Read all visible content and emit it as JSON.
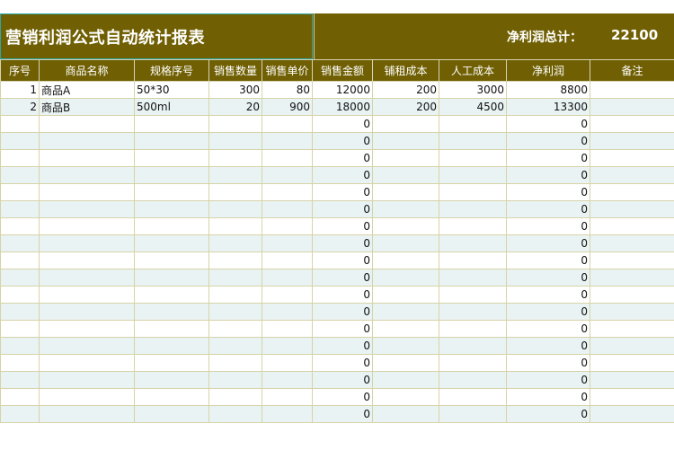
{
  "title": "营销利润公式自动统计报表",
  "summary": {
    "label": "净利润总计：",
    "value": "22100"
  },
  "headers": [
    "序号",
    "商品名称",
    "规格序号",
    "销售数量",
    "销售单价",
    "销售金额",
    "铺租成本",
    "人工成本",
    "净利润",
    "备注"
  ],
  "rows": [
    [
      "1",
      "商品A",
      "50*30",
      "300",
      "80",
      "12000",
      "200",
      "3000",
      "8800",
      ""
    ],
    [
      "2",
      "商品B",
      "500ml",
      "20",
      "900",
      "18000",
      "200",
      "4500",
      "13300",
      ""
    ],
    [
      "",
      "",
      "",
      "",
      "",
      "0",
      "",
      "",
      "0",
      ""
    ],
    [
      "",
      "",
      "",
      "",
      "",
      "0",
      "",
      "",
      "0",
      ""
    ],
    [
      "",
      "",
      "",
      "",
      "",
      "0",
      "",
      "",
      "0",
      ""
    ],
    [
      "",
      "",
      "",
      "",
      "",
      "0",
      "",
      "",
      "0",
      ""
    ],
    [
      "",
      "",
      "",
      "",
      "",
      "0",
      "",
      "",
      "0",
      ""
    ],
    [
      "",
      "",
      "",
      "",
      "",
      "0",
      "",
      "",
      "0",
      ""
    ],
    [
      "",
      "",
      "",
      "",
      "",
      "0",
      "",
      "",
      "0",
      ""
    ],
    [
      "",
      "",
      "",
      "",
      "",
      "0",
      "",
      "",
      "0",
      ""
    ],
    [
      "",
      "",
      "",
      "",
      "",
      "0",
      "",
      "",
      "0",
      ""
    ],
    [
      "",
      "",
      "",
      "",
      "",
      "0",
      "",
      "",
      "0",
      ""
    ],
    [
      "",
      "",
      "",
      "",
      "",
      "0",
      "",
      "",
      "0",
      ""
    ],
    [
      "",
      "",
      "",
      "",
      "",
      "0",
      "",
      "",
      "0",
      ""
    ],
    [
      "",
      "",
      "",
      "",
      "",
      "0",
      "",
      "",
      "0",
      ""
    ],
    [
      "",
      "",
      "",
      "",
      "",
      "0",
      "",
      "",
      "0",
      ""
    ],
    [
      "",
      "",
      "",
      "",
      "",
      "0",
      "",
      "",
      "0",
      ""
    ],
    [
      "",
      "",
      "",
      "",
      "",
      "0",
      "",
      "",
      "0",
      ""
    ],
    [
      "",
      "",
      "",
      "",
      "",
      "0",
      "",
      "",
      "0",
      ""
    ],
    [
      "",
      "",
      "",
      "",
      "",
      "0",
      "",
      "",
      "0",
      ""
    ]
  ],
  "colors": {
    "header_bg": "#706003",
    "alt_row_bg": "#eaf3f4",
    "selection_border": "#2aa7a3"
  }
}
